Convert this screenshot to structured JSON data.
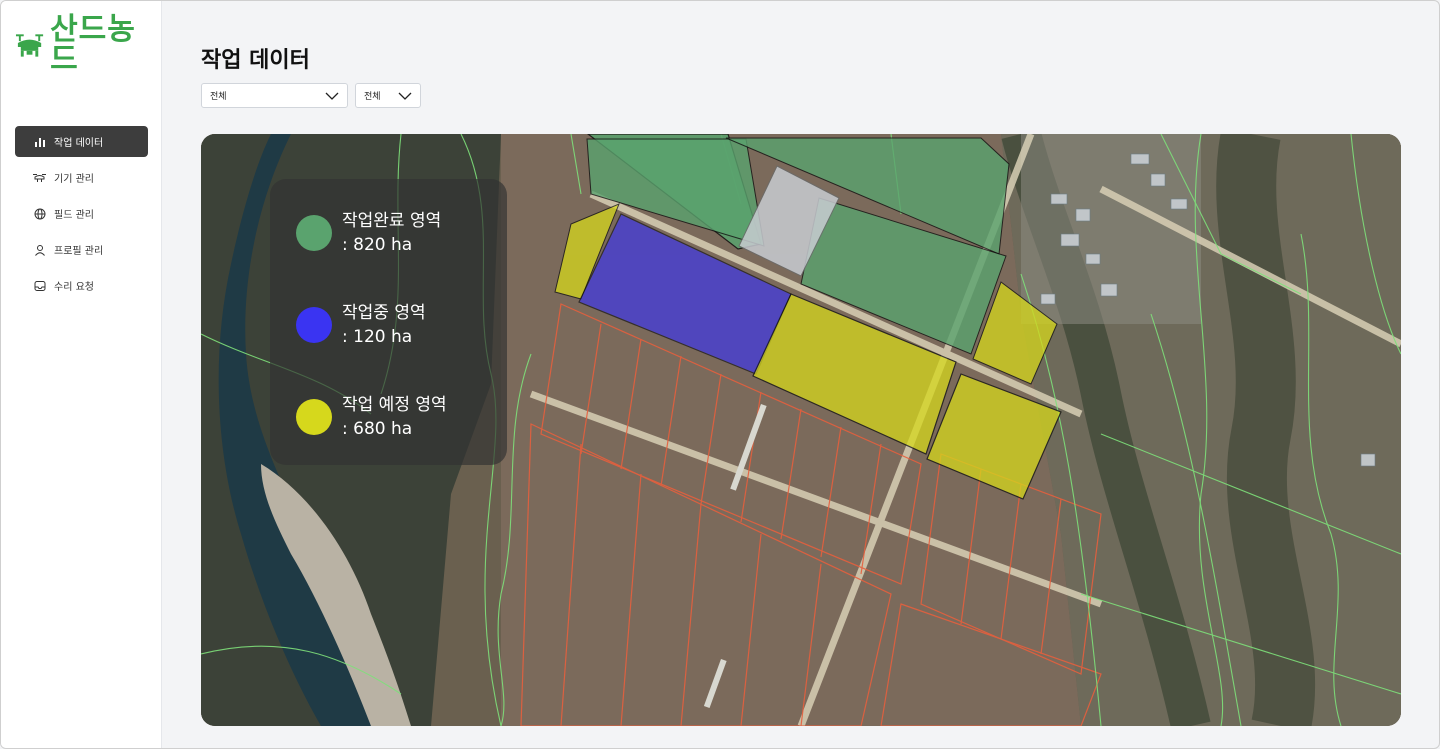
{
  "app": {
    "logo_text": "산드농드"
  },
  "sidebar": {
    "items": [
      {
        "label": "작업 데이터",
        "icon": "bar-chart-icon",
        "active": true
      },
      {
        "label": "기기 관리",
        "icon": "drone-icon",
        "active": false
      },
      {
        "label": "필드 관리",
        "icon": "globe-icon",
        "active": false
      },
      {
        "label": "프로필 관리",
        "icon": "user-icon",
        "active": false
      },
      {
        "label": "수리 요청",
        "icon": "inbox-icon",
        "active": false
      }
    ]
  },
  "page": {
    "title": "작업 데이터"
  },
  "filters": [
    {
      "value": "전체"
    },
    {
      "value": "전체"
    }
  ],
  "legend": [
    {
      "label": "작업완료 영역",
      "value": ": 820 ha",
      "color": "#5aa36e"
    },
    {
      "label": "작업중 영역",
      "value": ": 120 ha",
      "color": "#3a34f2"
    },
    {
      "label": "작업 예정 영역",
      "value": ": 680 ha",
      "color": "#d6d81c"
    }
  ],
  "colors": {
    "accent_green": "#3aa64b",
    "active_nav": "#3d3d3d",
    "field_boundary_red": "#e05a3a",
    "parcel_green": "#7ee07a"
  }
}
